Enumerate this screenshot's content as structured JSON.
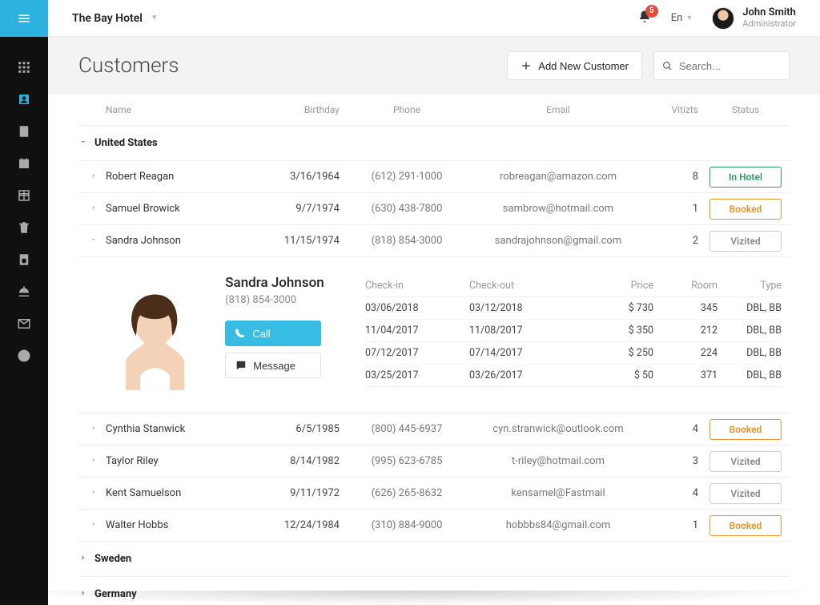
{
  "header": {
    "hotel_name": "The Bay Hotel",
    "notification_count": "5",
    "language": "En",
    "user_name": "John Smith",
    "user_role": "Administrator"
  },
  "page": {
    "title": "Customers",
    "add_button": "Add New Customer",
    "search_placeholder": "Search..."
  },
  "columns": {
    "name": "Name",
    "birthday": "Birthday",
    "phone": "Phone",
    "email": "Email",
    "visits": "Vitizts",
    "status": "Status"
  },
  "groups": {
    "us": "United States",
    "se": "Sweden",
    "de": "Germany"
  },
  "rows": {
    "r1": {
      "name": "Robert Reagan",
      "birthday": "3/16/1964",
      "phone": "(612) 291-1000",
      "email": "robreagan@amazon.com",
      "visits": "8",
      "status": "In Hotel"
    },
    "r2": {
      "name": "Samuel Browick",
      "birthday": "9/7/1974",
      "phone": "(630) 438-7800",
      "email": "sambrow@hotmail.com",
      "visits": "1",
      "status": "Booked"
    },
    "r3": {
      "name": "Sandra Johnson",
      "birthday": "11/15/1974",
      "phone": "(818) 854-3000",
      "email": "sandrajohnson@gmail.com",
      "visits": "2",
      "status": "Vizited"
    },
    "r4": {
      "name": "Cynthia Stanwick",
      "birthday": "6/5/1985",
      "phone": "(800) 445-6937",
      "email": "cyn.stranwick@outlook.com",
      "visits": "4",
      "status": "Booked"
    },
    "r5": {
      "name": "Taylor Riley",
      "birthday": "8/14/1982",
      "phone": "(995) 623-6785",
      "email": "t-riley@hotmail.com",
      "visits": "3",
      "status": "Vizited"
    },
    "r6": {
      "name": "Kent Samuelson",
      "birthday": "9/11/1972",
      "phone": "(626) 265-8632",
      "email": "kensamel@Fastmail",
      "visits": "4",
      "status": "Vizited"
    },
    "r7": {
      "name": "Walter Hobbs",
      "birthday": "12/24/1984",
      "phone": "(310) 884-9000",
      "email": "hobbbs84@gmail.com",
      "visits": "1",
      "status": "Booked"
    }
  },
  "detail": {
    "name": "Sandra Johnson",
    "phone": "(818) 854-3000",
    "call_label": "Call",
    "msg_label": "Message",
    "cols": {
      "checkin": "Check-in",
      "checkout": "Check-out",
      "price": "Price",
      "room": "Room",
      "type": "Type"
    },
    "visits": {
      "v1": {
        "in": "03/06/2018",
        "out": "03/12/2018",
        "price": "$ 730",
        "room": "345",
        "type": "DBL, BB"
      },
      "v2": {
        "in": "11/04/2017",
        "out": "11/08/2017",
        "price": "$ 350",
        "room": "212",
        "type": "DBL, BB"
      },
      "v3": {
        "in": "07/12/2017",
        "out": "07/14/2017",
        "price": "$ 250",
        "room": "224",
        "type": "DBL, BB"
      },
      "v4": {
        "in": "03/25/2017",
        "out": "03/26/2017",
        "price": "$ 50",
        "room": "371",
        "type": "DBL, BB"
      }
    }
  }
}
